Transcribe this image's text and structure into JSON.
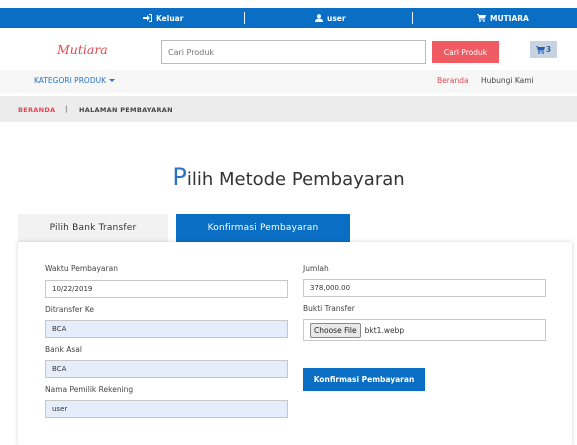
{
  "topbar": {
    "logout_label": "Keluar",
    "user_label": "user",
    "shop_label": "MUTIARA"
  },
  "header": {
    "logo": "Mutiara",
    "search_placeholder": "Cari Produk",
    "search_button": "Cari Produk",
    "cart_count": "3"
  },
  "nav": {
    "category_label": "KATEGORI PRODUK",
    "links": [
      "Beranda",
      "Hubungi Kami"
    ]
  },
  "breadcrumb": {
    "home": "BERANDA",
    "separator": "|",
    "current": "HALAMAN PEMBAYARAN"
  },
  "page": {
    "title_first": "P",
    "title_rest": "ilih Metode Pembayaran"
  },
  "tabs": [
    {
      "label": "Pilih Bank Transfer",
      "active": false
    },
    {
      "label": "Konfirmasi Pembayaran",
      "active": true
    }
  ],
  "form": {
    "waktu_label": "Waktu Pembayaran",
    "waktu_value": "10/22/2019",
    "ditransfer_label": "Ditransfer Ke",
    "ditransfer_value": "BCA",
    "bank_asal_label": "Bank Asal",
    "bank_asal_value": "BCA",
    "pemilik_label": "Nama Pemilik Rekening",
    "pemilik_value": "user",
    "jumlah_label": "Jumlah",
    "jumlah_value": "378,000.00",
    "bukti_label": "Bukti Transfer",
    "choose_file_label": "Choose File",
    "file_name": "bkt1.webp",
    "submit_label": "Konfirmasi Pembayaran"
  },
  "colors": {
    "primary_blue": "#0a6fc4",
    "accent_red": "#ef5b63",
    "readonly_field": "#e6edfa"
  }
}
